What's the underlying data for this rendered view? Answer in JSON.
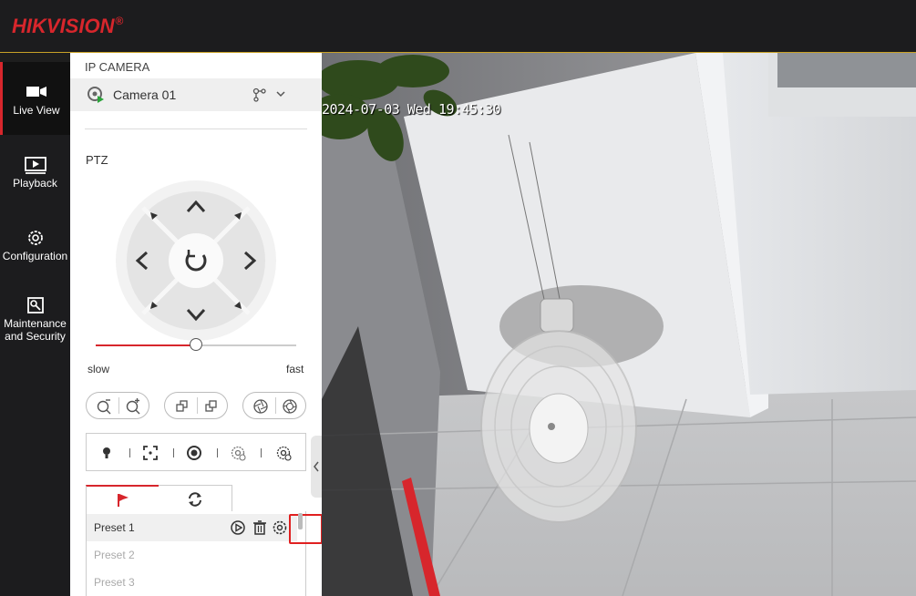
{
  "header": {
    "logo_hik": "HIK",
    "logo_vision": "VISION",
    "logo_reg": "®"
  },
  "nav": {
    "items": [
      {
        "label": "Live View",
        "icon": "camera-icon",
        "active": true
      },
      {
        "label": "Playback",
        "icon": "playback-icon",
        "active": false
      },
      {
        "label": "Configuration",
        "icon": "gear-icon",
        "active": false
      },
      {
        "label_line1": "Maintenance",
        "label_line2": "and Security",
        "icon": "maintenance-icon",
        "active": false
      }
    ]
  },
  "panel": {
    "title": "IP CAMERA",
    "camera_name": "Camera 01",
    "ptz_label": "PTZ",
    "speed": {
      "slow_label": "slow",
      "fast_label": "fast",
      "value_fraction": 0.5
    }
  },
  "presets": {
    "items": [
      {
        "name": "Preset 1",
        "selected": true
      },
      {
        "name": "Preset 2",
        "selected": false
      },
      {
        "name": "Preset 3",
        "selected": false
      }
    ]
  },
  "video": {
    "osd_timestamp": "2024-07-03 Wed 19:45:30"
  },
  "colors": {
    "brand_red": "#d7262c",
    "header_bg": "#1c1c1e",
    "accent_line": "#c9a227"
  }
}
